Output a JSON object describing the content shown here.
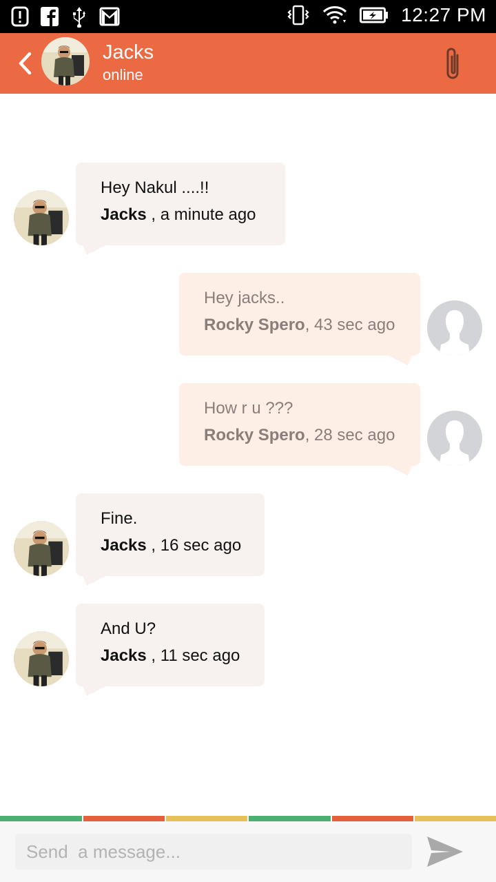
{
  "status_bar": {
    "time": "12:27 PM",
    "icons": [
      "alert-icon",
      "facebook-icon",
      "usb-icon",
      "gmail-icon",
      "vibrate-icon",
      "wifi-icon",
      "battery-charging-icon"
    ]
  },
  "header": {
    "contact_name": "Jacks",
    "contact_status": "online",
    "back_icon": "chevron-left-icon",
    "attach_icon": "paperclip-icon",
    "color": "#eb6a43"
  },
  "messages": [
    {
      "direction": "incoming",
      "text": "Hey Nakul ....!!",
      "sender": "Jacks",
      "time": " , a minute ago"
    },
    {
      "direction": "outgoing",
      "text": "Hey jacks..",
      "sender": "Rocky Spero",
      "time": ", 43 sec ago"
    },
    {
      "direction": "outgoing",
      "text": "How r u ???",
      "sender": "Rocky Spero",
      "time": ", 28 sec ago"
    },
    {
      "direction": "incoming",
      "text": "Fine.",
      "sender": "Jacks",
      "time": " , 16 sec ago"
    },
    {
      "direction": "incoming",
      "text": "And U?",
      "sender": "Jacks",
      "time": " , 11 sec ago"
    }
  ],
  "composer": {
    "placeholder": "Send  a message...",
    "value": "",
    "send_icon": "send-icon"
  },
  "colors": {
    "incoming_bubble": "#f7f2ef",
    "outgoing_bubble": "#fdeee6",
    "stripe_green": "#4caf72",
    "stripe_orange": "#e4603b",
    "stripe_yellow": "#e8c05a"
  }
}
